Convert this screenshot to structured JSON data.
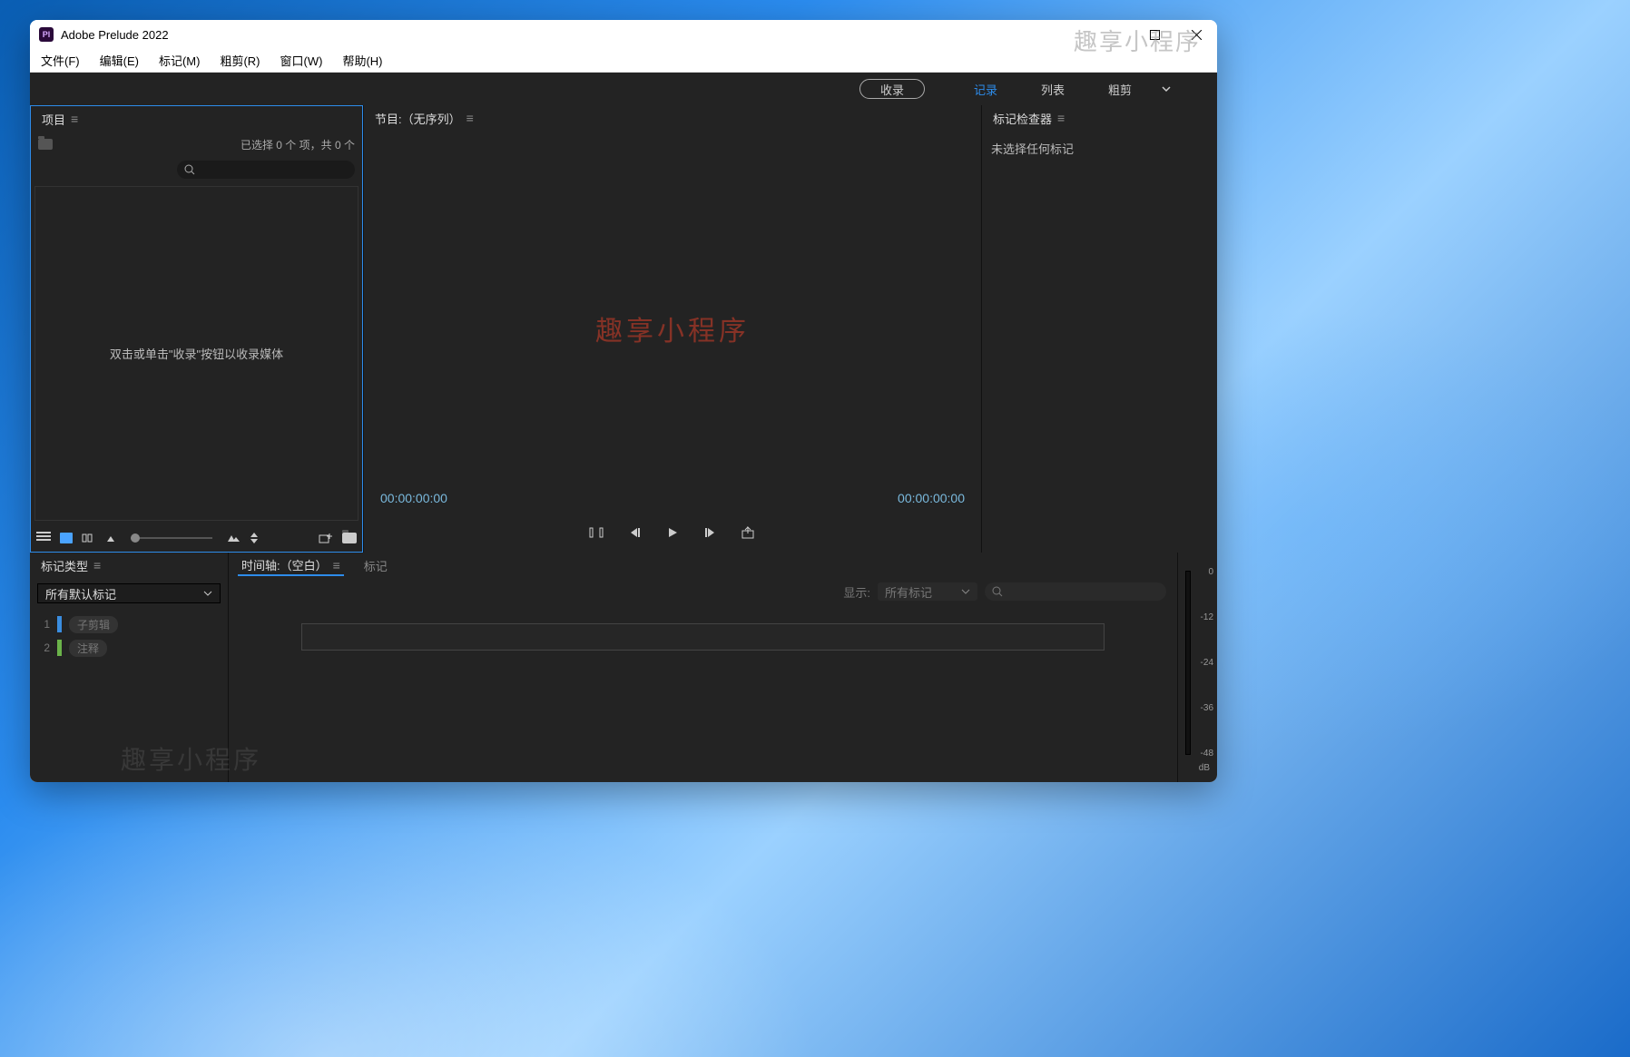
{
  "app": {
    "title": "Adobe Prelude 2022",
    "icon_text": "Pl"
  },
  "menubar": [
    {
      "label": "文件(F)"
    },
    {
      "label": "编辑(E)"
    },
    {
      "label": "标记(M)"
    },
    {
      "label": "粗剪(R)"
    },
    {
      "label": "窗口(W)"
    },
    {
      "label": "帮助(H)"
    }
  ],
  "workspaces": {
    "pill": "收录",
    "tabs": [
      {
        "label": "记录",
        "active": true
      },
      {
        "label": "列表",
        "active": false
      },
      {
        "label": "粗剪",
        "active": false
      }
    ]
  },
  "project": {
    "tab": "项目",
    "status": "已选择 0 个 项，共 0 个",
    "search_placeholder": "",
    "empty_hint": "双击或单击\"收录\"按钮以收录媒体"
  },
  "program": {
    "tab": "节目:（无序列）",
    "tc_left": "00:00:00:00",
    "tc_right": "00:00:00:00"
  },
  "marker_inspector": {
    "tab": "标记检查器",
    "empty": "未选择任何标记"
  },
  "marker_type": {
    "tab": "标记类型",
    "dropdown": "所有默认标记",
    "rows": [
      {
        "n": "1",
        "color": "blue",
        "label": "子剪辑"
      },
      {
        "n": "2",
        "color": "green",
        "label": "注释"
      }
    ]
  },
  "timeline": {
    "tab_active": "时间轴:（空白）",
    "tab_inactive": "标记",
    "filter_label": "显示:",
    "filter_value": "所有标记"
  },
  "audio_meter": {
    "labels": [
      "0",
      "-12",
      "-24",
      "-36",
      "-48"
    ],
    "unit": "dB"
  },
  "watermark": "趣享小程序"
}
